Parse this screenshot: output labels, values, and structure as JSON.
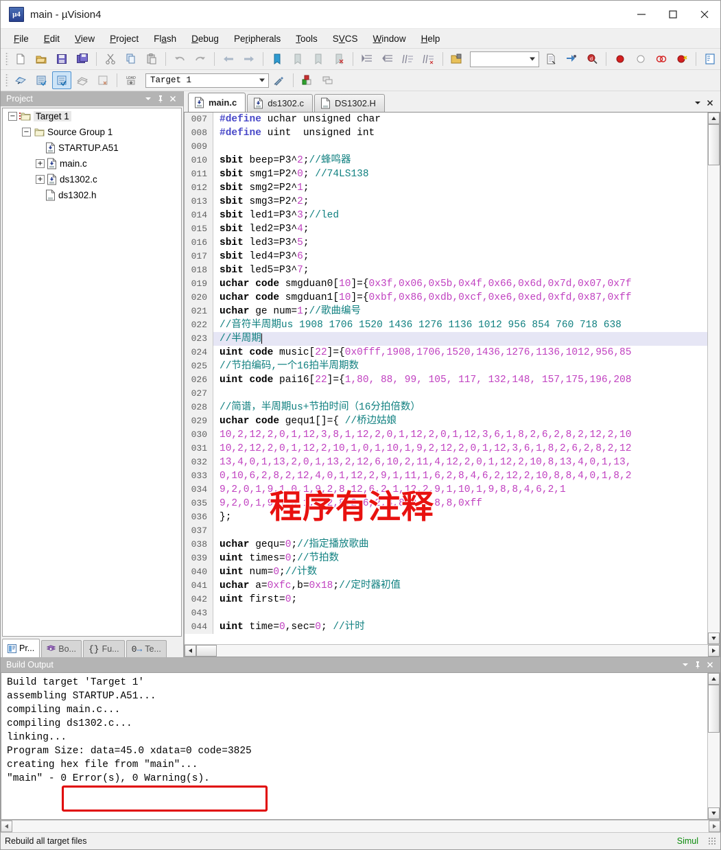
{
  "window": {
    "title": "main  - µVision4",
    "app_icon": "uvision-logo-icon",
    "minimize": "–",
    "maximize": "□",
    "close": "✕"
  },
  "menubar": {
    "items": [
      {
        "pre": "",
        "mn": "F",
        "post": "ile"
      },
      {
        "pre": "",
        "mn": "E",
        "post": "dit"
      },
      {
        "pre": "",
        "mn": "V",
        "post": "iew"
      },
      {
        "pre": "",
        "mn": "P",
        "post": "roject"
      },
      {
        "pre": "Fl",
        "mn": "a",
        "post": "sh"
      },
      {
        "pre": "",
        "mn": "D",
        "post": "ebug"
      },
      {
        "pre": "Pe",
        "mn": "r",
        "post": "ipherals"
      },
      {
        "pre": "",
        "mn": "T",
        "post": "ools"
      },
      {
        "pre": "S",
        "mn": "V",
        "post": "CS"
      },
      {
        "pre": "",
        "mn": "W",
        "post": "indow"
      },
      {
        "pre": "",
        "mn": "H",
        "post": "elp"
      }
    ]
  },
  "toolbar_main": {
    "buttons": [
      "new-file-icon",
      "open-file-icon",
      "save-icon",
      "save-all-icon",
      "cut-icon",
      "copy-icon",
      "paste-icon",
      "undo-icon",
      "redo-icon",
      "navigate-back-icon",
      "navigate-forward-icon",
      "bookmark-toggle-icon",
      "bookmark-prev-icon",
      "bookmark-next-icon",
      "bookmark-clear-icon",
      "indent-increase-icon",
      "indent-decrease-icon",
      "comment-lines-icon",
      "uncomment-lines-icon",
      "open-folder-icon"
    ],
    "search_value": "",
    "search_placeholder": "",
    "after_search": [
      "find-in-files-icon",
      "bind-icon",
      "find-icon",
      "breakpoint-insert-icon",
      "breakpoint-disable-icon",
      "breakpoint-kill-all-icon",
      "breakpoint-disable-all-icon",
      "configuration-wizard-icon"
    ]
  },
  "toolbar_build": {
    "buttons": [
      "translate-file-icon",
      "build-target-icon",
      "rebuild-all-icon",
      "batch-build-icon",
      "stop-build-icon",
      "download-icon"
    ],
    "active_index": 2,
    "target_value": "Target 1",
    "after_target": [
      "target-options-icon",
      "manage-components-icon",
      "multi-project-icon"
    ]
  },
  "project_panel": {
    "title": "Project",
    "header_icons": [
      "chevron-down-icon",
      "pin-icon",
      "close-icon"
    ],
    "tree": [
      {
        "indent": 0,
        "expander": "-",
        "icon": "target-folder-icon",
        "label": "Target 1",
        "selected": true
      },
      {
        "indent": 1,
        "expander": "-",
        "icon": "group-folder-icon",
        "label": "Source Group 1",
        "selected": false
      },
      {
        "indent": 2,
        "expander": "",
        "icon": "asm-file-icon",
        "label": "STARTUP.A51",
        "selected": false
      },
      {
        "indent": 2,
        "expander": "+",
        "icon": "c-file-icon",
        "label": "main.c",
        "selected": false
      },
      {
        "indent": 2,
        "expander": "+",
        "icon": "c-file-icon",
        "label": "ds1302.c",
        "selected": false
      },
      {
        "indent": 2,
        "expander": "",
        "icon": "h-file-icon",
        "label": "ds1302.h",
        "selected": false
      }
    ],
    "bottom_tabs": [
      {
        "icon": "project-icon",
        "label": "Pr...",
        "selected": true
      },
      {
        "icon": "books-icon",
        "label": "Bo...",
        "selected": false
      },
      {
        "icon": "functions-icon",
        "label": "Fu...",
        "selected": false
      },
      {
        "icon": "templates-icon",
        "label": "Te...",
        "selected": false
      }
    ]
  },
  "editor": {
    "tabs": [
      {
        "icon": "c-file-icon",
        "label": "main.c",
        "selected": true
      },
      {
        "icon": "c-file-icon",
        "label": "ds1302.c",
        "selected": false
      },
      {
        "icon": "h-file-icon",
        "label": "DS1302.H",
        "selected": false
      }
    ],
    "tab_controls": [
      "chevron-down-icon",
      "close-icon"
    ],
    "current_line": 23,
    "lines": [
      {
        "n": "007",
        "tokens": [
          {
            "t": "#define ",
            "c": "pp"
          },
          {
            "t": "uchar unsigned char",
            "c": "plain"
          }
        ]
      },
      {
        "n": "008",
        "tokens": [
          {
            "t": "#define ",
            "c": "pp"
          },
          {
            "t": "uint  unsigned int",
            "c": "plain"
          }
        ]
      },
      {
        "n": "009",
        "tokens": []
      },
      {
        "n": "010",
        "tokens": [
          {
            "t": "sbit",
            "c": "kw"
          },
          {
            "t": " beep=P3^",
            "c": "plain"
          },
          {
            "t": "2",
            "c": "num"
          },
          {
            "t": ";",
            "c": "plain"
          },
          {
            "t": "//蜂鸣器",
            "c": "cm"
          }
        ]
      },
      {
        "n": "011",
        "tokens": [
          {
            "t": "sbit",
            "c": "kw"
          },
          {
            "t": " smg1=P2^",
            "c": "plain"
          },
          {
            "t": "0",
            "c": "num"
          },
          {
            "t": "; ",
            "c": "plain"
          },
          {
            "t": "//74LS138",
            "c": "cm"
          }
        ]
      },
      {
        "n": "012",
        "tokens": [
          {
            "t": "sbit",
            "c": "kw"
          },
          {
            "t": " smg2=P2^",
            "c": "plain"
          },
          {
            "t": "1",
            "c": "num"
          },
          {
            "t": ";",
            "c": "plain"
          }
        ]
      },
      {
        "n": "013",
        "tokens": [
          {
            "t": "sbit",
            "c": "kw"
          },
          {
            "t": " smg3=P2^",
            "c": "plain"
          },
          {
            "t": "2",
            "c": "num"
          },
          {
            "t": ";",
            "c": "plain"
          }
        ]
      },
      {
        "n": "014",
        "tokens": [
          {
            "t": "sbit",
            "c": "kw"
          },
          {
            "t": " led1=P3^",
            "c": "plain"
          },
          {
            "t": "3",
            "c": "num"
          },
          {
            "t": ";",
            "c": "plain"
          },
          {
            "t": "//led",
            "c": "cm"
          }
        ]
      },
      {
        "n": "015",
        "tokens": [
          {
            "t": "sbit",
            "c": "kw"
          },
          {
            "t": " led2=P3^",
            "c": "plain"
          },
          {
            "t": "4",
            "c": "num"
          },
          {
            "t": ";",
            "c": "plain"
          }
        ]
      },
      {
        "n": "016",
        "tokens": [
          {
            "t": "sbit",
            "c": "kw"
          },
          {
            "t": " led3=P3^",
            "c": "plain"
          },
          {
            "t": "5",
            "c": "num"
          },
          {
            "t": ";",
            "c": "plain"
          }
        ]
      },
      {
        "n": "017",
        "tokens": [
          {
            "t": "sbit",
            "c": "kw"
          },
          {
            "t": " led4=P3^",
            "c": "plain"
          },
          {
            "t": "6",
            "c": "num"
          },
          {
            "t": ";",
            "c": "plain"
          }
        ]
      },
      {
        "n": "018",
        "tokens": [
          {
            "t": "sbit",
            "c": "kw"
          },
          {
            "t": " led5=P3^",
            "c": "plain"
          },
          {
            "t": "7",
            "c": "num"
          },
          {
            "t": ";",
            "c": "plain"
          }
        ]
      },
      {
        "n": "019",
        "tokens": [
          {
            "t": "uchar code",
            "c": "kw"
          },
          {
            "t": " smgduan0[",
            "c": "plain"
          },
          {
            "t": "10",
            "c": "num"
          },
          {
            "t": "]={",
            "c": "plain"
          },
          {
            "t": "0x3f,0x06,0x5b,0x4f,0x66,0x6d,0x7d,0x07,0x7f",
            "c": "num"
          }
        ]
      },
      {
        "n": "020",
        "tokens": [
          {
            "t": "uchar code",
            "c": "kw"
          },
          {
            "t": " smgduan1[",
            "c": "plain"
          },
          {
            "t": "10",
            "c": "num"
          },
          {
            "t": "]={",
            "c": "plain"
          },
          {
            "t": "0xbf,0x86,0xdb,0xcf,0xe6,0xed,0xfd,0x87,0xff",
            "c": "num"
          }
        ]
      },
      {
        "n": "021",
        "tokens": [
          {
            "t": "uchar",
            "c": "kw"
          },
          {
            "t": " ge num=",
            "c": "plain"
          },
          {
            "t": "1",
            "c": "num"
          },
          {
            "t": ";",
            "c": "plain"
          },
          {
            "t": "//歌曲编号",
            "c": "cm"
          }
        ]
      },
      {
        "n": "022",
        "tokens": [
          {
            "t": "//音符半周期us 1908 1706 1520 1436 1276 1136 1012 956 854 760 718 638",
            "c": "cm"
          }
        ]
      },
      {
        "n": "023",
        "tokens": [
          {
            "t": "//半周期",
            "c": "cm"
          }
        ],
        "current": true
      },
      {
        "n": "024",
        "tokens": [
          {
            "t": "uint code",
            "c": "kw"
          },
          {
            "t": " music[",
            "c": "plain"
          },
          {
            "t": "22",
            "c": "num"
          },
          {
            "t": "]={",
            "c": "plain"
          },
          {
            "t": "0x0fff,1908,1706,1520,1436,1276,1136,1012,956,85",
            "c": "num"
          }
        ]
      },
      {
        "n": "025",
        "tokens": [
          {
            "t": "//节拍编码,一个16拍半周期数",
            "c": "cm"
          }
        ]
      },
      {
        "n": "026",
        "tokens": [
          {
            "t": "uint code",
            "c": "kw"
          },
          {
            "t": " pai16[",
            "c": "plain"
          },
          {
            "t": "22",
            "c": "num"
          },
          {
            "t": "]={",
            "c": "plain"
          },
          {
            "t": "1,80, 88, 99, 105, 117, 132,148, 157,175,196,208",
            "c": "num"
          }
        ]
      },
      {
        "n": "027",
        "tokens": []
      },
      {
        "n": "028",
        "tokens": [
          {
            "t": "//简谱，半周期us+节拍时间（16分拍倍数）",
            "c": "cm"
          }
        ]
      },
      {
        "n": "029",
        "tokens": [
          {
            "t": "uchar code",
            "c": "kw"
          },
          {
            "t": " gequ1[]={ ",
            "c": "plain"
          },
          {
            "t": "//桥边姑娘",
            "c": "cm"
          }
        ]
      },
      {
        "n": "030",
        "tokens": [
          {
            "t": "10,2,12,2,0,1,12,3,8,1,12,2,0,1,12,2,0,1,12,3,6,1,8,2,6,2,8,2,12,2,10",
            "c": "num"
          }
        ]
      },
      {
        "n": "031",
        "tokens": [
          {
            "t": "10,2,12,2,0,1,12,2,10,1,0,1,10,1,9,2,12,2,0,1,12,3,6,1,8,2,6,2,8,2,12",
            "c": "num"
          }
        ]
      },
      {
        "n": "032",
        "tokens": [
          {
            "t": "13,4,0,1,13,2,0,1,13,2,12,6,10,2,11,4,12,2,0,1,12,2,10,8,13,4,0,1,13,",
            "c": "num"
          }
        ]
      },
      {
        "n": "033",
        "tokens": [
          {
            "t": "0,10,6,2,8,2,12,4,0,1,12,2,9,1,11,1,6,2,8,4,6,2,12,2,10,8,8,4,0,1,8,2",
            "c": "num"
          }
        ]
      },
      {
        "n": "034",
        "tokens": [
          {
            "t": "9,2,0,1,9,1,0,1,9,2,8,12,6,2,1,12,2,9,1,10,1,9,8,8,4,6,2,1",
            "c": "num"
          }
        ]
      },
      {
        "n": "035",
        "tokens": [
          {
            "t": "9,2,0,1,9,1,0,1,9,2,8,2,6,2,8,8,0,1,8,8,0xff",
            "c": "num"
          }
        ]
      },
      {
        "n": "036",
        "tokens": [
          {
            "t": "};",
            "c": "plain"
          }
        ]
      },
      {
        "n": "037",
        "tokens": []
      },
      {
        "n": "038",
        "tokens": [
          {
            "t": "uchar",
            "c": "kw"
          },
          {
            "t": " gequ=",
            "c": "plain"
          },
          {
            "t": "0",
            "c": "num"
          },
          {
            "t": ";",
            "c": "plain"
          },
          {
            "t": "//指定播放歌曲",
            "c": "cm"
          }
        ]
      },
      {
        "n": "039",
        "tokens": [
          {
            "t": "uint",
            "c": "kw"
          },
          {
            "t": " times=",
            "c": "plain"
          },
          {
            "t": "0",
            "c": "num"
          },
          {
            "t": ";",
            "c": "plain"
          },
          {
            "t": "//节拍数",
            "c": "cm"
          }
        ]
      },
      {
        "n": "040",
        "tokens": [
          {
            "t": "uint",
            "c": "kw"
          },
          {
            "t": " num=",
            "c": "plain"
          },
          {
            "t": "0",
            "c": "num"
          },
          {
            "t": ";",
            "c": "plain"
          },
          {
            "t": "//计数",
            "c": "cm"
          }
        ]
      },
      {
        "n": "041",
        "tokens": [
          {
            "t": "uchar",
            "c": "kw"
          },
          {
            "t": " a=",
            "c": "plain"
          },
          {
            "t": "0xfc",
            "c": "num"
          },
          {
            "t": ",b=",
            "c": "plain"
          },
          {
            "t": "0x18",
            "c": "num"
          },
          {
            "t": ";",
            "c": "plain"
          },
          {
            "t": "//定时器初值",
            "c": "cm"
          }
        ]
      },
      {
        "n": "042",
        "tokens": [
          {
            "t": "uint",
            "c": "kw"
          },
          {
            "t": " first=",
            "c": "plain"
          },
          {
            "t": "0",
            "c": "num"
          },
          {
            "t": ";",
            "c": "plain"
          }
        ]
      },
      {
        "n": "043",
        "tokens": []
      },
      {
        "n": "044",
        "tokens": [
          {
            "t": "uint",
            "c": "kw"
          },
          {
            "t": " time=",
            "c": "plain"
          },
          {
            "t": "0",
            "c": "num"
          },
          {
            "t": ",sec=",
            "c": "plain"
          },
          {
            "t": "0",
            "c": "num"
          },
          {
            "t": "; ",
            "c": "plain"
          },
          {
            "t": "//计时",
            "c": "cm"
          }
        ]
      }
    ]
  },
  "overlay": {
    "text": "程序有注释",
    "color": "#e8110f"
  },
  "build_output": {
    "title": "Build Output",
    "header_icons": [
      "chevron-down-icon",
      "pin-icon",
      "close-icon"
    ],
    "lines": [
      "Build target 'Target 1'",
      "assembling STARTUP.A51...",
      "compiling main.c...",
      "compiling ds1302.c...",
      "linking...",
      "Program Size: data=45.0 xdata=0 code=3825",
      "creating hex file from \"main\"...",
      "\"main\" - 0 Error(s), 0 Warning(s)."
    ],
    "highlight": {
      "text": "0 Error(s), 0 Warning(s).",
      "color": "#e00000"
    }
  },
  "statusbar": {
    "left": "Rebuild all target files",
    "right": "Simul"
  }
}
